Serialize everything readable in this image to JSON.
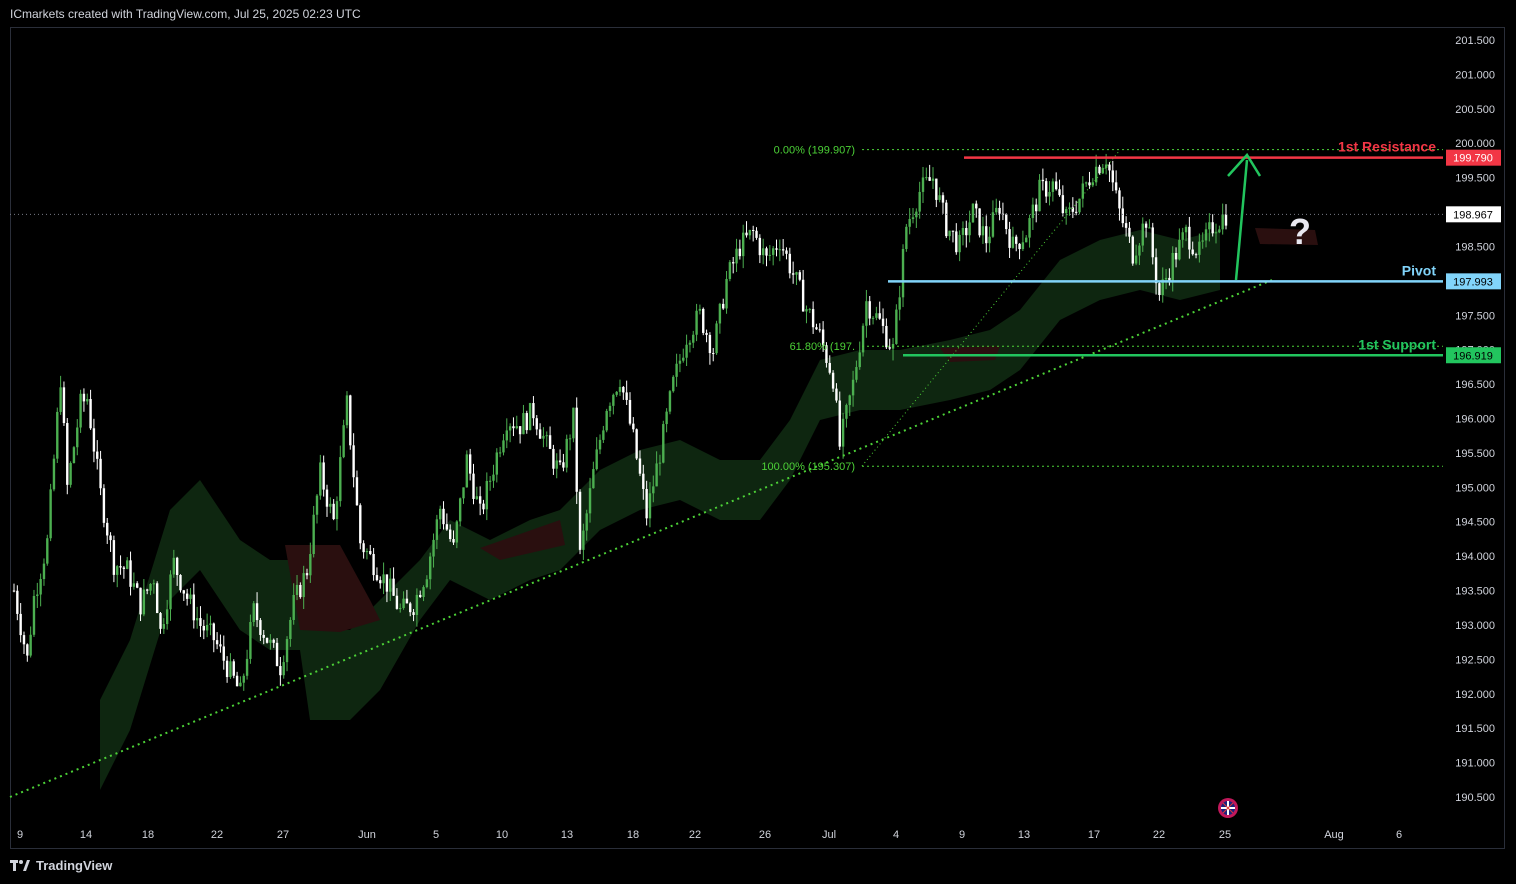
{
  "header": {
    "attribution": "ICmarkets created with TradingView.com, Jul 25, 2025 02:23 UTC"
  },
  "footer": {
    "brand": "TradingView"
  },
  "colors": {
    "up": "#4caf50",
    "down": "#ffffff",
    "resistance": "#f23645",
    "pivot": "#81d4fa",
    "support": "#22c55e",
    "fib": "#4cd137",
    "cloud_bull": "#0f2a12",
    "cloud_bear": "#2a0f0f",
    "price_label_bg": "#ffffff"
  },
  "chart_data": {
    "type": "candlestick",
    "ylim": [
      190.2,
      201.75
    ],
    "y_ticks": [
      "201.500",
      "201.000",
      "200.500",
      "200.000",
      "199.500",
      "199.000",
      "198.500",
      "198.000",
      "197.500",
      "197.000",
      "196.500",
      "196.000",
      "195.500",
      "195.000",
      "194.500",
      "194.000",
      "193.500",
      "193.000",
      "192.500",
      "192.000",
      "191.500",
      "191.000",
      "190.500"
    ],
    "x_ticks": [
      "9",
      "14",
      "18",
      "22",
      "27",
      "Jun",
      "5",
      "10",
      "13",
      "18",
      "22",
      "26",
      "Jul",
      "4",
      "9",
      "13",
      "17",
      "22",
      "25",
      "Aug",
      "6"
    ],
    "current_price": "198.967",
    "levels": [
      {
        "name": "1st Resistance",
        "value": 199.79,
        "label": "199.790",
        "color": "#f23645"
      },
      {
        "name": "Pivot",
        "value": 197.993,
        "label": "197.993",
        "color": "#81d4fa"
      },
      {
        "name": "1st Support",
        "value": 196.919,
        "label": "196.919",
        "color": "#22c55e"
      }
    ],
    "fibonacci": [
      {
        "label": "0.00% (199.907)",
        "value": 199.907
      },
      {
        "label": "61.80% (197.",
        "value": 197.05
      },
      {
        "label": "100.00% (195.307)",
        "value": 195.307
      }
    ],
    "annotation": "?",
    "price_path": [
      [
        0,
        193.5
      ],
      [
        2,
        192.5
      ],
      [
        3,
        193.4
      ],
      [
        5,
        194.2
      ],
      [
        7,
        196.6
      ],
      [
        8,
        195.0
      ],
      [
        10,
        196.2
      ],
      [
        11,
        196.3
      ],
      [
        13,
        194.9
      ],
      [
        15,
        193.9
      ],
      [
        17,
        193.8
      ],
      [
        19,
        193.3
      ],
      [
        21,
        193.7
      ],
      [
        22,
        192.9
      ],
      [
        24,
        193.9
      ],
      [
        26,
        193.4
      ],
      [
        28,
        193.0
      ],
      [
        30,
        192.8
      ],
      [
        32,
        192.4
      ],
      [
        34,
        192.0
      ],
      [
        36,
        193.2
      ],
      [
        38,
        192.8
      ],
      [
        40,
        192.4
      ],
      [
        42,
        193.3
      ],
      [
        44,
        193.8
      ],
      [
        46,
        195.2
      ],
      [
        48,
        194.5
      ],
      [
        50,
        196.2
      ],
      [
        52,
        194.2
      ],
      [
        54,
        193.9
      ],
      [
        56,
        193.6
      ],
      [
        58,
        193.2
      ],
      [
        60,
        193.3
      ],
      [
        62,
        193.8
      ],
      [
        64,
        194.7
      ],
      [
        66,
        194.1
      ],
      [
        68,
        195.4
      ],
      [
        70,
        194.6
      ],
      [
        72,
        195.3
      ],
      [
        74,
        196.0
      ],
      [
        76,
        195.9
      ],
      [
        78,
        196.1
      ],
      [
        80,
        195.6
      ],
      [
        82,
        195.2
      ],
      [
        84,
        196.0
      ],
      [
        85,
        194.0
      ],
      [
        87,
        195.2
      ],
      [
        89,
        196.2
      ],
      [
        91,
        196.6
      ],
      [
        93,
        195.7
      ],
      [
        95,
        194.6
      ],
      [
        97,
        195.5
      ],
      [
        99,
        196.5
      ],
      [
        101,
        197.2
      ],
      [
        103,
        197.5
      ],
      [
        105,
        197.0
      ],
      [
        107,
        198.0
      ],
      [
        109,
        198.5
      ],
      [
        111,
        198.7
      ],
      [
        113,
        198.3
      ],
      [
        115,
        198.6
      ],
      [
        117,
        198.1
      ],
      [
        119,
        197.6
      ],
      [
        121,
        197.2
      ],
      [
        123,
        196.6
      ],
      [
        124,
        195.6
      ],
      [
        126,
        196.5
      ],
      [
        128,
        197.7
      ],
      [
        130,
        197.4
      ],
      [
        132,
        197.0
      ],
      [
        134,
        198.8
      ],
      [
        136,
        199.3
      ],
      [
        138,
        199.5
      ],
      [
        140,
        198.8
      ],
      [
        142,
        198.5
      ],
      [
        144,
        199.0
      ],
      [
        146,
        198.6
      ],
      [
        148,
        199.1
      ],
      [
        150,
        198.5
      ],
      [
        152,
        198.7
      ],
      [
        154,
        199.3
      ],
      [
        156,
        199.4
      ],
      [
        158,
        198.9
      ],
      [
        160,
        199.2
      ],
      [
        162,
        199.6
      ],
      [
        164,
        199.8
      ],
      [
        166,
        199.0
      ],
      [
        168,
        198.4
      ],
      [
        170,
        198.9
      ],
      [
        172,
        197.8
      ],
      [
        174,
        198.3
      ],
      [
        176,
        198.7
      ],
      [
        178,
        198.4
      ],
      [
        180,
        198.8
      ],
      [
        182,
        198.97
      ]
    ],
    "projection_arrow": "up to 1st Resistance"
  }
}
